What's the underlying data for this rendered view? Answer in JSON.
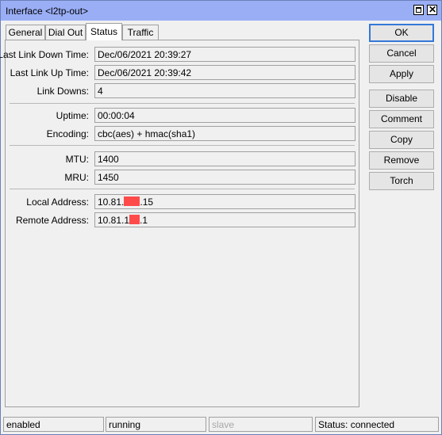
{
  "window": {
    "title": "Interface <l2tp-out>",
    "maximize_icon": "maximize-icon",
    "close_icon": "close-icon"
  },
  "tabs": [
    {
      "label": "General",
      "active": false
    },
    {
      "label": "Dial Out",
      "active": false
    },
    {
      "label": "Status",
      "active": true
    },
    {
      "label": "Traffic",
      "active": false
    }
  ],
  "status": {
    "last_link_down_time": {
      "label": "Last Link Down Time:",
      "value": "Dec/06/2021 20:39:27"
    },
    "last_link_up_time": {
      "label": "Last Link Up Time:",
      "value": "Dec/06/2021 20:39:42"
    },
    "link_downs": {
      "label": "Link Downs:",
      "value": "4"
    },
    "uptime": {
      "label": "Uptime:",
      "value": "00:00:04"
    },
    "encoding": {
      "label": "Encoding:",
      "value": "cbc(aes) + hmac(sha1)"
    },
    "mtu": {
      "label": "MTU:",
      "value": "1400"
    },
    "mru": {
      "label": "MRU:",
      "value": "1450"
    },
    "local_address": {
      "label": "Local Address:",
      "prefix": "10.81.",
      "suffix": ".15"
    },
    "remote_address": {
      "label": "Remote Address:",
      "prefix": "10.81.1",
      "suffix": ".1"
    }
  },
  "buttons": {
    "ok": "OK",
    "cancel": "Cancel",
    "apply": "Apply",
    "disable": "Disable",
    "comment": "Comment",
    "copy": "Copy",
    "remove": "Remove",
    "torch": "Torch"
  },
  "statusbar": {
    "enabled": "enabled",
    "running": "running",
    "slave": "slave",
    "connection": "Status: connected"
  },
  "colors": {
    "titlebar": "#9aaef6",
    "default_button_border": "#3378d8",
    "redaction": "#ff4a4a"
  }
}
